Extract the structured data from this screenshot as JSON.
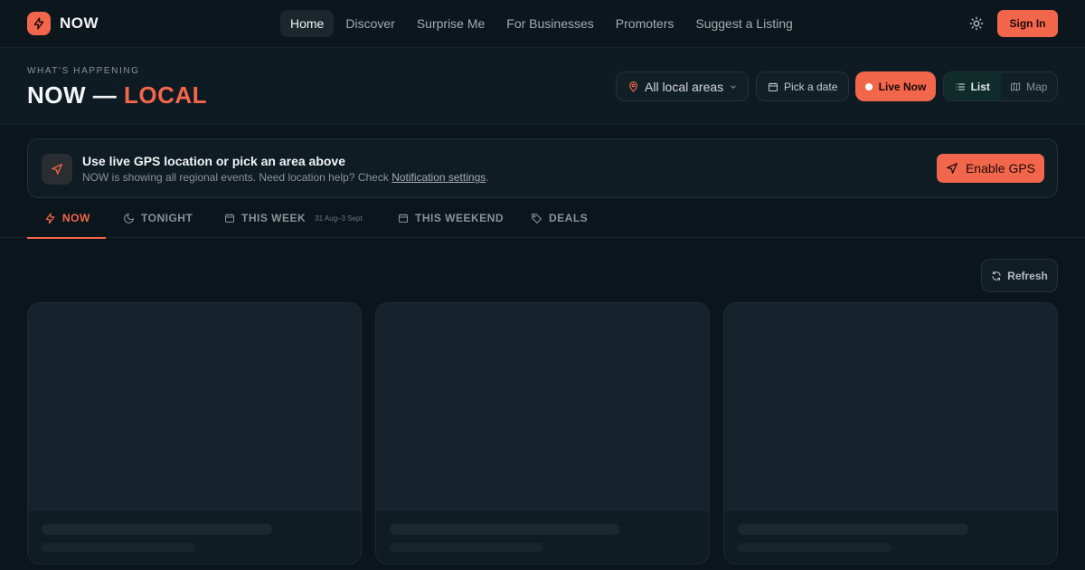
{
  "brand": {
    "name": "NOW",
    "accent": "#f2674c",
    "logo_icon": "lightning-icon"
  },
  "nav": {
    "links": [
      "Home",
      "Discover",
      "Surprise Me",
      "For Businesses",
      "Promoters",
      "Suggest a Listing"
    ],
    "active": "Home",
    "theme_icon": "sun-icon",
    "sign_in": "Sign In"
  },
  "header": {
    "eyebrow": "WHAT'S HAPPENING",
    "title_main": "NOW — ",
    "title_accent": "LOCAL",
    "area_select": "All local areas",
    "date_button": "Pick a date",
    "live_button": "Live Now",
    "view": {
      "list": "List",
      "map": "Map",
      "active": "List"
    }
  },
  "gps_banner": {
    "title": "Use live GPS location or pick an area above",
    "subtitle_prefix": "NOW is showing all regional events. Need location help? Check ",
    "subtitle_link": "Notification settings",
    "subtitle_suffix": ".",
    "button": "Enable GPS"
  },
  "tabs": [
    {
      "label": "NOW",
      "icon": "lightning-icon",
      "active": true
    },
    {
      "label": "TONIGHT",
      "icon": "moon-icon"
    },
    {
      "label": "THIS WEEK",
      "icon": "calendar-icon",
      "sub": "31 Aug–3 Sept"
    },
    {
      "label": "THIS WEEKEND",
      "icon": "calendar-icon"
    },
    {
      "label": "DEALS",
      "icon": "tag-icon"
    }
  ],
  "refresh": "Refresh"
}
